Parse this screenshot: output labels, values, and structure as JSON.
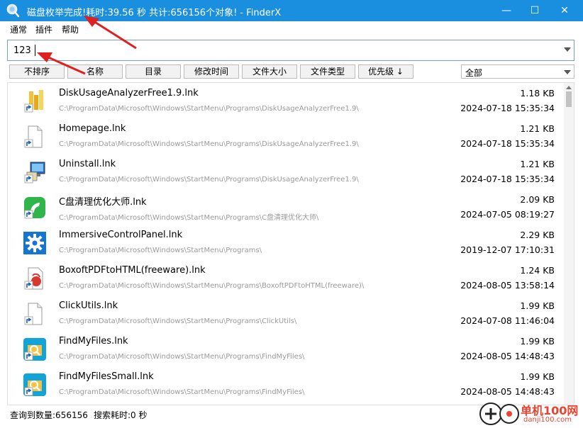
{
  "window": {
    "title": "磁盘枚举完成!耗时:39.56 秒 共计:656156个对象!  - FinderX",
    "minimize": "—",
    "maximize": "☐",
    "close": "✕"
  },
  "menu": [
    "通常",
    "插件",
    "帮助"
  ],
  "search": {
    "value": "123"
  },
  "sort_buttons": [
    "不排序",
    "名称",
    "目录",
    "修改时间",
    "文件大小",
    "文件类型",
    "优先级 ↓"
  ],
  "filter": {
    "selected": "全部"
  },
  "results": [
    {
      "icon": "disk-analyzer-icon",
      "name": "DiskUsageAnalyzerFree1.9.lnk",
      "path": "C:\\ProgramData\\Microsoft\\Windows\\StartMenu\\Programs\\DiskUsageAnalyzerFree1.9\\",
      "size": "1.18 KB",
      "date": "2024-07-18 15:35:34"
    },
    {
      "icon": "blank-shortcut-icon",
      "name": "Homepage.lnk",
      "path": "C:\\ProgramData\\Microsoft\\Windows\\StartMenu\\Programs\\DiskUsageAnalyzerFree1.9\\",
      "size": "1.21 KB",
      "date": "2024-07-18 15:35:34"
    },
    {
      "icon": "uninstall-icon",
      "name": "Uninstall.lnk",
      "path": "C:\\ProgramData\\Microsoft\\Windows\\StartMenu\\Programs\\DiskUsageAnalyzerFree1.9\\",
      "size": "1.21 KB",
      "date": "2024-07-18 15:35:34"
    },
    {
      "icon": "cleaner-icon",
      "name": "C盘清理优化大师.lnk",
      "path": "C:\\ProgramData\\Microsoft\\Windows\\StartMenu\\Programs\\C盘清理优化大师\\",
      "size": "2.09 KB",
      "date": "2024-07-05 08:19:27"
    },
    {
      "icon": "control-panel-gear-icon",
      "name": "ImmersiveControlPanel.lnk",
      "path": "C:\\ProgramData\\Microsoft\\Windows\\StartMenu\\Programs\\",
      "size": "2.29 KB",
      "date": "2019-12-07 17:10:31"
    },
    {
      "icon": "pdf-to-html-icon",
      "name": "BoxoftPDFtoHTML(freeware).lnk",
      "path": "C:\\ProgramData\\Microsoft\\Windows\\StartMenu\\Programs\\BoxoftPDFtoHTML(freeware)\\",
      "size": "1.24 KB",
      "date": "2024-08-05 13:58:14"
    },
    {
      "icon": "blank-shortcut-icon",
      "name": "ClickUtils.lnk",
      "path": "C:\\ProgramData\\Microsoft\\Windows\\StartMenu\\Programs\\ClickUtils\\",
      "size": "1.99 KB",
      "date": "2024-07-08 11:46:04"
    },
    {
      "icon": "find-files-icon",
      "name": "FindMyFiles.lnk",
      "path": "C:\\ProgramData\\Microsoft\\Windows\\StartMenu\\Programs\\FindMyFiles\\",
      "size": "1.99 KB",
      "date": "2024-08-05 14:48:43"
    },
    {
      "icon": "find-files-icon",
      "name": "FindMyFilesSmall.lnk",
      "path": "C:\\ProgramData\\Microsoft\\Windows\\StartMenu\\Programs\\FindMyFiles\\",
      "size": "1.99 KB",
      "date": "2024-08-05 14:48:43"
    }
  ],
  "status": {
    "count": "查询到数量:656156",
    "time": "搜索耗时:0 秒"
  },
  "watermark": {
    "text": "单机100网",
    "sub": "danji100.com"
  },
  "colors": {
    "titlebar": "#1a8fe0",
    "annotation_arrow": "#e02020",
    "watermark": "#e8442e"
  }
}
